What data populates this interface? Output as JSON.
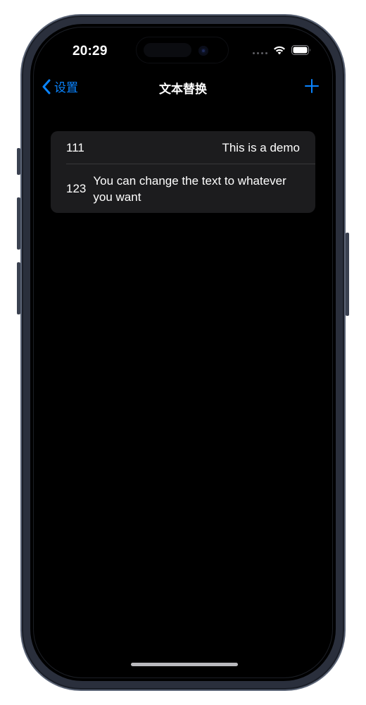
{
  "status_bar": {
    "time": "20:29",
    "icons": [
      "cellular-dots-icon",
      "wifi-icon",
      "battery-icon"
    ]
  },
  "nav": {
    "back_label": "设置",
    "title": "文本替换",
    "add_icon": "plus-icon"
  },
  "replacements": [
    {
      "shortcut": "111",
      "phrase": "This is a demo"
    },
    {
      "shortcut": "123",
      "phrase": "You can change the text to whatever you want"
    }
  ],
  "colors": {
    "accent": "#0a84ff",
    "background": "#000000",
    "cell": "#1c1c1e",
    "separator": "#38383a",
    "text": "#ffffff",
    "device_frame": "#2a2f3c"
  }
}
